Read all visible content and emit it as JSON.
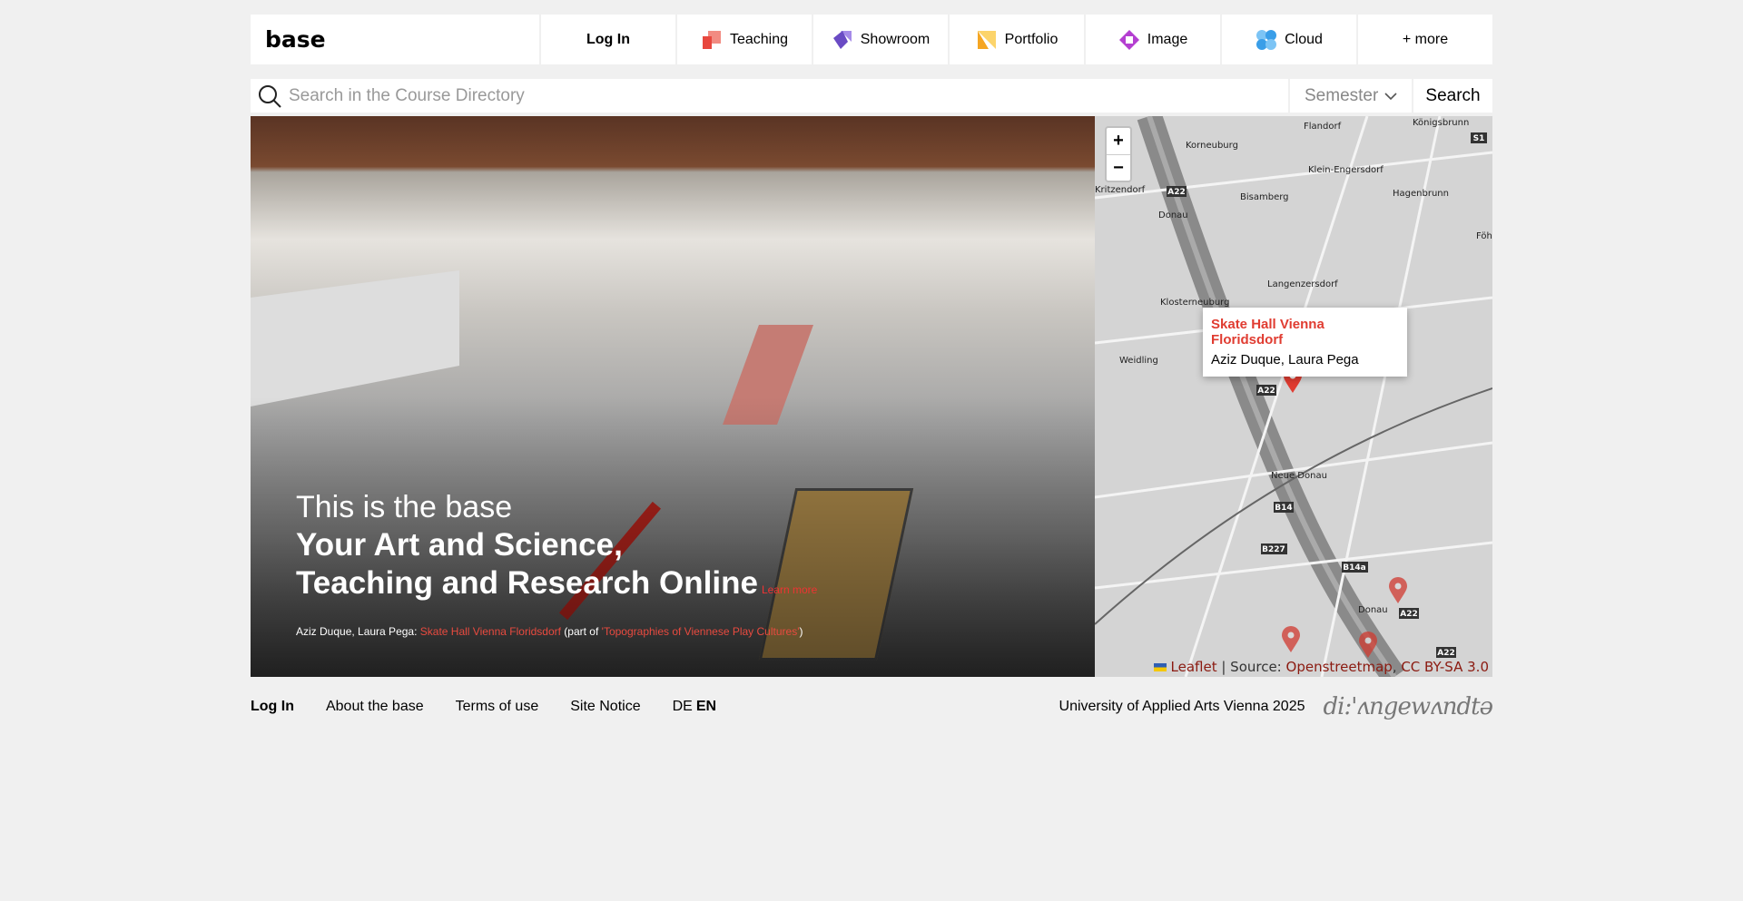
{
  "nav": {
    "logo": "base",
    "login": "Log In",
    "items": [
      {
        "label": "Teaching",
        "icon": "teaching-icon",
        "color": "#e8473e"
      },
      {
        "label": "Showroom",
        "icon": "showroom-icon",
        "color": "#6a4bc4"
      },
      {
        "label": "Portfolio",
        "icon": "portfolio-icon",
        "color": "#f5a623"
      },
      {
        "label": "Image",
        "icon": "image-icon",
        "color": "#b43fd1"
      },
      {
        "label": "Cloud",
        "icon": "cloud-icon",
        "color": "#3a9ee8"
      }
    ],
    "more": "+ more"
  },
  "search": {
    "placeholder": "Search in the Course Directory",
    "value": "",
    "semester": "Semester",
    "button": "Search"
  },
  "hero": {
    "line1": "This is the base",
    "line2": "Your Art and Science,",
    "line3": "Teaching and Research Online",
    "learn_more": "Learn more",
    "credit_authors": "Aziz Duque, Laura Pega: ",
    "credit_project": "Skate Hall Vienna Floridsdorf",
    "credit_part_of": " (part of ",
    "credit_series": "'Topographies of Viennese Play Cultures'",
    "credit_close": ")"
  },
  "map": {
    "zoom_in": "+",
    "zoom_out": "−",
    "popup_title": "Skate Hall Vienna Floridsdorf",
    "popup_authors": "Aziz Duque, Laura Pega",
    "places": [
      "Korneuburg",
      "Flandorf",
      "Königsbrunn",
      "Klein-Engersdorf",
      "Bisamberg",
      "Hagenbrunn",
      "Kritzendorf",
      "Donau",
      "Langenzersdorf",
      "Klosterneuburg",
      "Weidling",
      "Neue Donau",
      "Donau",
      "Föhr"
    ],
    "roads": [
      "A22",
      "A22",
      "B14",
      "B227",
      "B14a",
      "A22",
      "A22",
      "S1"
    ],
    "attribution_leaflet": "Leaflet",
    "attribution_source": " | Source: ",
    "attribution_osm": "Openstreetmap",
    "attribution_license": "CC BY-SA 3.0",
    "marker_color": "#e03c31"
  },
  "footer": {
    "login": "Log In",
    "about": "About the base",
    "terms": "Terms of use",
    "notice": "Site Notice",
    "lang_de": "DE",
    "lang_en": "EN",
    "university": "University of Applied Arts Vienna 2025",
    "logo": "di:'ʌngewʌndtə"
  }
}
